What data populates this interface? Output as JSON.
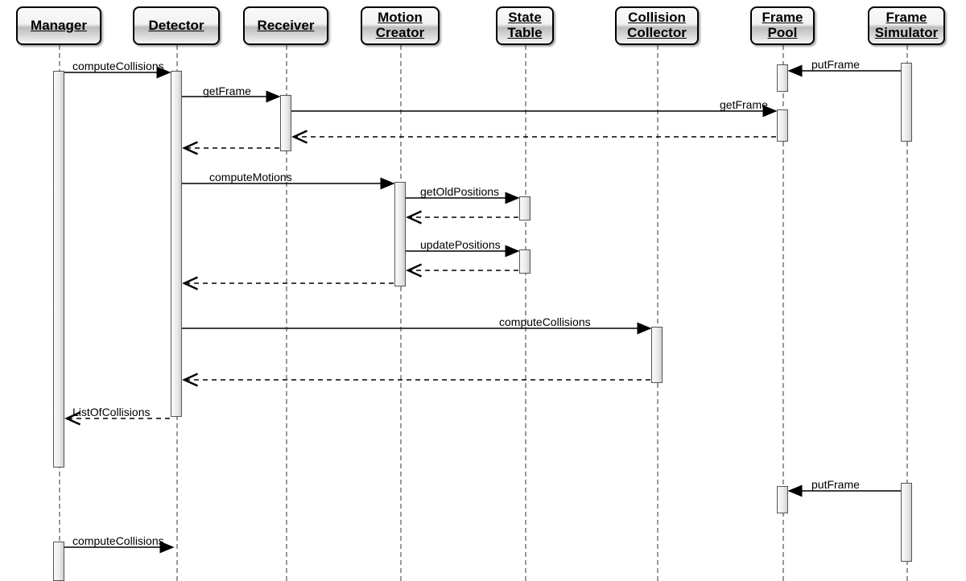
{
  "participants": {
    "manager": "Manager",
    "detector": "Detector",
    "receiver": "Receiver",
    "motion": "Motion\nCreator",
    "state": "State\nTable",
    "collector": "Collision\nCollector",
    "pool": "Frame\nPool",
    "simulator": "Frame\nSimulator"
  },
  "messages": {
    "computeCollisions1": "computeCollisions",
    "getFrame1": "getFrame",
    "getFrame2": "getFrame",
    "putFrame1": "putFrame",
    "computeMotions": "computeMotions",
    "getOldPositions": "getOldPositions",
    "updatePositions": "updatePositions",
    "computeCollisions2": "computeCollisions",
    "listOfCollisions": "ListOfCollisions",
    "putFrame2": "putFrame",
    "computeCollisions3": "computeCollisions"
  }
}
